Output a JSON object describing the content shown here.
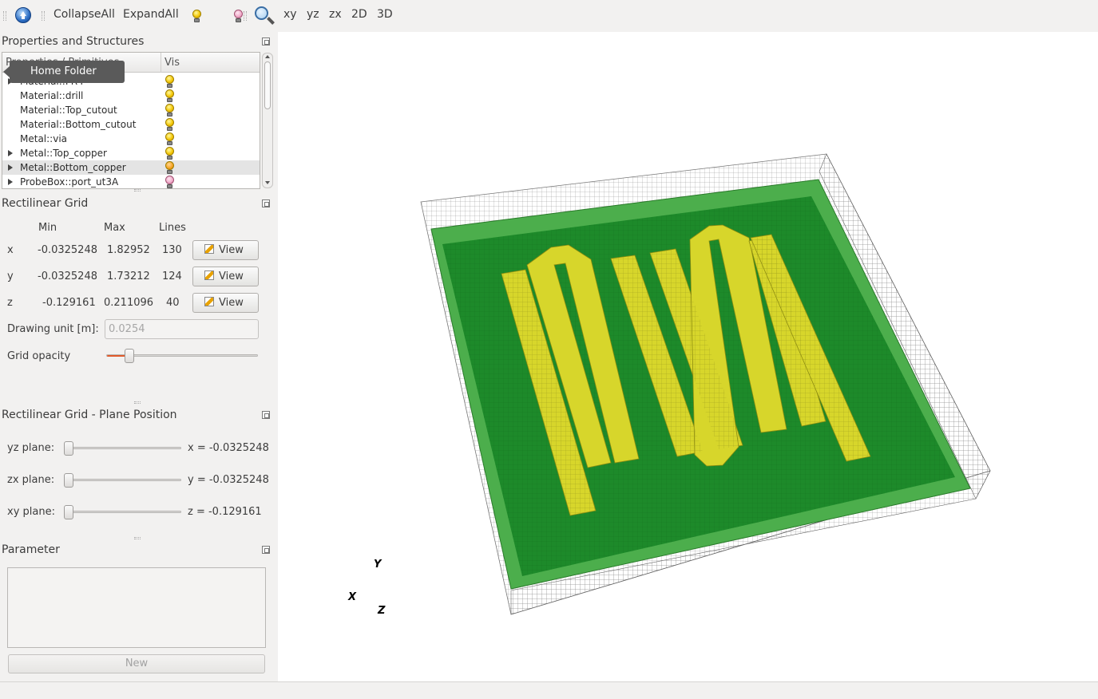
{
  "toolbar": {
    "collapse_all": "CollapseAll",
    "expand_all": "ExpandAll",
    "view_xy": "xy",
    "view_yz": "yz",
    "view_zx": "zx",
    "view_2d": "2D",
    "view_3d": "3D",
    "icons": [
      "home-folder-icon",
      "bulb-on-icon",
      "bulb-off-icon",
      "zoom-icon"
    ]
  },
  "tooltip": {
    "text": "Home Folder"
  },
  "properties_panel": {
    "title": "Properties and Structures",
    "columns": [
      "Properties / Primitives",
      "Vis"
    ],
    "rows": [
      {
        "label": "Material::FR4",
        "expandable": true,
        "vis": "yellow"
      },
      {
        "label": "Material::drill",
        "expandable": false,
        "vis": "yellow"
      },
      {
        "label": "Material::Top_cutout",
        "expandable": false,
        "vis": "yellow"
      },
      {
        "label": "Material::Bottom_cutout",
        "expandable": false,
        "vis": "yellow"
      },
      {
        "label": "Metal::via",
        "expandable": false,
        "vis": "yellow"
      },
      {
        "label": "Metal::Top_copper",
        "expandable": true,
        "vis": "yellow"
      },
      {
        "label": "Metal::Bottom_copper",
        "expandable": true,
        "vis": "orange",
        "selected": true
      },
      {
        "label": "ProbeBox::port_ut3A",
        "expandable": true,
        "vis": "pink"
      }
    ]
  },
  "grid_panel": {
    "title": "Rectilinear Grid",
    "headers": {
      "min": "Min",
      "max": "Max",
      "lines": "Lines"
    },
    "rows": [
      {
        "axis": "x",
        "min": "-0.0325248",
        "max": "1.82952",
        "lines": "130",
        "button": "View"
      },
      {
        "axis": "y",
        "min": "-0.0325248",
        "max": "1.73212",
        "lines": "124",
        "button": "View"
      },
      {
        "axis": "z",
        "min": "-0.129161",
        "max": "0.211096",
        "lines": "40",
        "button": "View"
      }
    ],
    "drawing_unit_label": "Drawing unit [m]:",
    "drawing_unit_value": "0.0254",
    "opacity_label": "Grid opacity",
    "opacity_level": 0.15
  },
  "plane_panel": {
    "title": "Rectilinear Grid - Plane Position",
    "rows": [
      {
        "label": "yz plane:",
        "value": "x = -0.0325248",
        "level": 0
      },
      {
        "label": "zx plane:",
        "value": "y = -0.0325248",
        "level": 0
      },
      {
        "label": "xy plane:",
        "value": "z = -0.129161",
        "level": 0
      }
    ]
  },
  "parameter_panel": {
    "title": "Parameter",
    "new_button": "New"
  },
  "viewport": {
    "axes": {
      "y": "Y",
      "x": "X",
      "z": "Z"
    },
    "colors": {
      "substrate": "#1d8a2a",
      "substrate_edge": "#4cae4c",
      "copper": "#d7d62b",
      "mesh": "#8a8a8a"
    }
  }
}
